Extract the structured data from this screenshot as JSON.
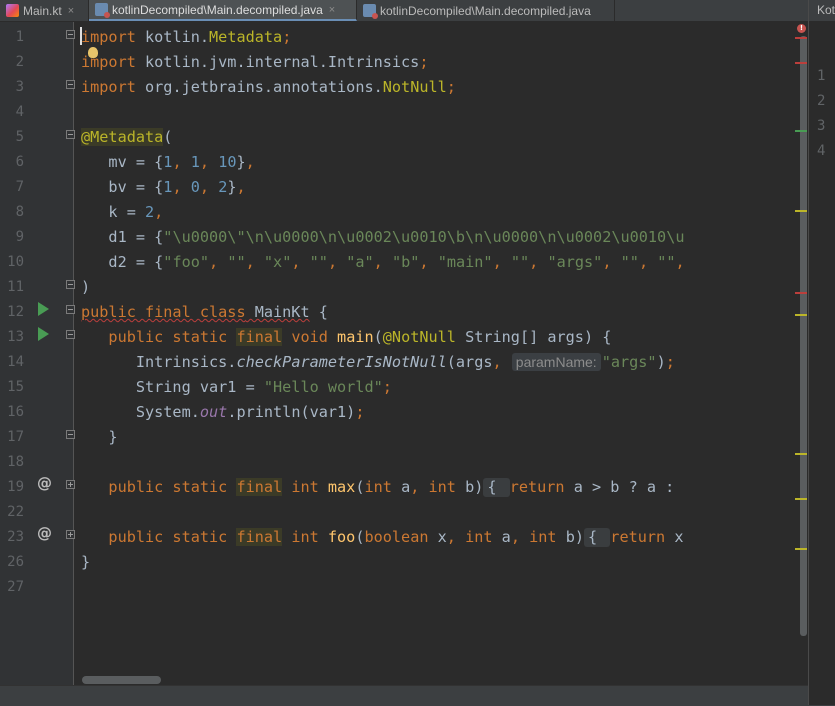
{
  "tabs": [
    {
      "label": "Main.kt",
      "icon": "kotlin-file-icon",
      "active": false,
      "closable": true
    },
    {
      "label": "kotlinDecompiled\\Main.decompiled.java",
      "icon": "java-file-icon",
      "active": true,
      "closable": true
    },
    {
      "label": "kotlinDecompiled\\Main.decompiled.java",
      "icon": "java-file-icon",
      "active": false,
      "closable": false
    }
  ],
  "close_glyph": "×",
  "hint": {
    "param_name": "paramName:"
  },
  "fold_placeholders": {
    "max_open": "{ ",
    "foo_open": "{ "
  },
  "colors": {
    "keyword": "#cc7832",
    "annotation": "#bbb529",
    "string": "#6a8759",
    "number": "#6897bb",
    "text": "#a9b7c6",
    "background": "#2b2b2b",
    "gutter": "#313335",
    "run_icon": "#499c54",
    "error": "#c75450"
  },
  "lines": [
    {
      "n": "1",
      "segs": [
        [
          "kw",
          "import"
        ],
        [
          "t",
          " kotlin."
        ],
        [
          "ann",
          "Metadata"
        ],
        [
          "kw",
          ";"
        ]
      ]
    },
    {
      "n": "2",
      "segs": [
        [
          "kw",
          "import"
        ],
        [
          "t",
          " kotlin.jvm.internal.Intrinsics"
        ],
        [
          "kw",
          ";"
        ]
      ]
    },
    {
      "n": "3",
      "segs": [
        [
          "kw",
          "import"
        ],
        [
          "t",
          " org.jetbrains.annotations."
        ],
        [
          "ann",
          "NotNull"
        ],
        [
          "kw",
          ";"
        ]
      ]
    },
    {
      "n": "4",
      "segs": []
    },
    {
      "n": "5",
      "segs": [
        [
          "annhl",
          "@Metadata"
        ],
        [
          "t",
          "("
        ]
      ]
    },
    {
      "n": "6",
      "segs": [
        [
          "t",
          "   mv = {"
        ],
        [
          "num",
          "1"
        ],
        [
          "kw",
          ", "
        ],
        [
          "num",
          "1"
        ],
        [
          "kw",
          ", "
        ],
        [
          "num",
          "10"
        ],
        [
          "t",
          "}"
        ],
        [
          "kw",
          ","
        ]
      ]
    },
    {
      "n": "7",
      "segs": [
        [
          "t",
          "   bv = {"
        ],
        [
          "num",
          "1"
        ],
        [
          "kw",
          ", "
        ],
        [
          "num",
          "0"
        ],
        [
          "kw",
          ", "
        ],
        [
          "num",
          "2"
        ],
        [
          "t",
          "}"
        ],
        [
          "kw",
          ","
        ]
      ]
    },
    {
      "n": "8",
      "segs": [
        [
          "t",
          "   k = "
        ],
        [
          "num",
          "2"
        ],
        [
          "kw",
          ","
        ]
      ]
    },
    {
      "n": "9",
      "segs": [
        [
          "t",
          "   d1 = {"
        ],
        [
          "str",
          "\"\\u0000\\\"\\n\\u0000\\n\\u0002\\u0010\\b\\n\\u0000\\n\\u0002\\u0010\\u"
        ]
      ]
    },
    {
      "n": "10",
      "segs": [
        [
          "t",
          "   d2 = {"
        ],
        [
          "str",
          "\"foo\""
        ],
        [
          "kw",
          ", "
        ],
        [
          "str",
          "\"\""
        ],
        [
          "kw",
          ", "
        ],
        [
          "str",
          "\"x\""
        ],
        [
          "kw",
          ", "
        ],
        [
          "str",
          "\"\""
        ],
        [
          "kw",
          ", "
        ],
        [
          "str",
          "\"a\""
        ],
        [
          "kw",
          ", "
        ],
        [
          "str",
          "\"b\""
        ],
        [
          "kw",
          ", "
        ],
        [
          "str",
          "\"main\""
        ],
        [
          "kw",
          ", "
        ],
        [
          "str",
          "\"\""
        ],
        [
          "kw",
          ", "
        ],
        [
          "str",
          "\"args\""
        ],
        [
          "kw",
          ", "
        ],
        [
          "str",
          "\"\""
        ],
        [
          "kw",
          ", "
        ],
        [
          "str",
          "\"\""
        ],
        [
          "kw",
          ","
        ]
      ]
    },
    {
      "n": "11",
      "segs": [
        [
          "t",
          ")"
        ]
      ]
    },
    {
      "n": "12",
      "segs": [
        [
          "kwsq",
          "public final class"
        ],
        [
          "sq",
          " MainKt"
        ],
        [
          "t",
          " {"
        ]
      ]
    },
    {
      "n": "13",
      "segs": [
        [
          "kw",
          "   public static "
        ],
        [
          "kwhl",
          "final"
        ],
        [
          "kw",
          " void "
        ],
        [
          "fn",
          "main"
        ],
        [
          "t",
          "("
        ],
        [
          "ann",
          "@NotNull"
        ],
        [
          "t",
          " String[] args) {"
        ]
      ]
    },
    {
      "n": "14",
      "segs": [
        [
          "t",
          "      Intrinsics."
        ],
        [
          "it",
          "checkParameterIsNotNull"
        ],
        [
          "t",
          "(args"
        ],
        [
          "kw",
          ", "
        ],
        [
          "hint",
          "paramName:"
        ],
        [
          "str",
          "\"args\""
        ],
        [
          "t",
          ")"
        ],
        [
          "kw",
          ";"
        ]
      ]
    },
    {
      "n": "15",
      "segs": [
        [
          "t",
          "      String var1 = "
        ],
        [
          "str",
          "\"Hello world\""
        ],
        [
          "kw",
          ";"
        ]
      ]
    },
    {
      "n": "16",
      "segs": [
        [
          "t",
          "      System."
        ],
        [
          "field",
          "out"
        ],
        [
          "t",
          ".println(var1)"
        ],
        [
          "kw",
          ";"
        ]
      ]
    },
    {
      "n": "17",
      "segs": [
        [
          "t",
          "   }"
        ]
      ]
    },
    {
      "n": "18",
      "segs": []
    },
    {
      "n": "19",
      "segs": [
        [
          "kw",
          "   public static "
        ],
        [
          "kwhl",
          "final"
        ],
        [
          "kw",
          " int "
        ],
        [
          "fn",
          "max"
        ],
        [
          "t",
          "("
        ],
        [
          "kw",
          "int"
        ],
        [
          "t",
          " a"
        ],
        [
          "kw",
          ", "
        ],
        [
          "kw",
          "int"
        ],
        [
          "t",
          " b)"
        ],
        [
          "fold",
          "{ "
        ],
        [
          "kw",
          "return"
        ],
        [
          "t",
          " a > b ? a : "
        ]
      ]
    },
    {
      "n": "22",
      "segs": []
    },
    {
      "n": "23",
      "segs": [
        [
          "kw",
          "   public static "
        ],
        [
          "kwhl",
          "final"
        ],
        [
          "kw",
          " int "
        ],
        [
          "fn",
          "foo"
        ],
        [
          "t",
          "("
        ],
        [
          "kw",
          "boolean"
        ],
        [
          "t",
          " x"
        ],
        [
          "kw",
          ", "
        ],
        [
          "kw",
          "int"
        ],
        [
          "t",
          " a"
        ],
        [
          "kw",
          ", "
        ],
        [
          "kw",
          "int"
        ],
        [
          "t",
          " b)"
        ],
        [
          "fold",
          "{ "
        ],
        [
          "kw",
          "return"
        ],
        [
          "t",
          " x"
        ]
      ]
    },
    {
      "n": "26",
      "segs": [
        [
          "t",
          "}"
        ]
      ]
    },
    {
      "n": "27",
      "segs": []
    }
  ],
  "side_panel": {
    "title": "Kot",
    "line_numbers": [
      "1",
      "2",
      "3",
      "4"
    ]
  },
  "error_count_glyph": "!"
}
